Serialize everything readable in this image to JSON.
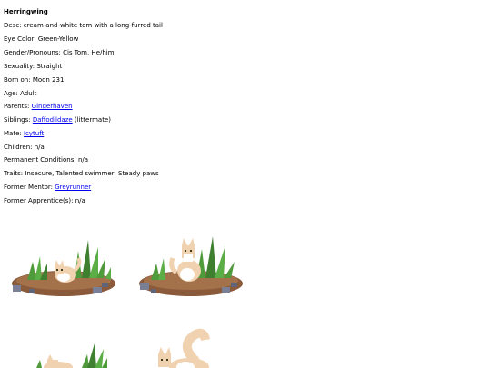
{
  "character": {
    "name": "Herringwing",
    "fields": [
      {
        "label": "Desc: ",
        "value": "cream-and-white tom with a long-furred tail",
        "link": "",
        "suffix": ""
      },
      {
        "label": "Eye Color: ",
        "value": "Green-Yellow",
        "link": "",
        "suffix": ""
      },
      {
        "label": "Gender/Pronouns: ",
        "value": "Cis Tom, He/him",
        "link": "",
        "suffix": ""
      },
      {
        "label": "Sexuality: ",
        "value": "Straight",
        "link": "",
        "suffix": ""
      },
      {
        "label": "Born on: ",
        "value": "Moon 231",
        "link": "",
        "suffix": ""
      },
      {
        "label": "Age: ",
        "value": "Adult",
        "link": "",
        "suffix": ""
      },
      {
        "label": "Parents: ",
        "value": "",
        "link": "Gingerhaven",
        "suffix": ""
      },
      {
        "label": "Siblings: ",
        "value": "",
        "link": "Daffodildaze",
        "suffix": " (littermate)"
      },
      {
        "label": "Mate: ",
        "value": "",
        "link": "Icytuft",
        "suffix": ""
      },
      {
        "label": "Children: ",
        "value": "n/a",
        "link": "",
        "suffix": ""
      },
      {
        "label": "Permanent Conditions: ",
        "value": "n/a",
        "link": "",
        "suffix": ""
      },
      {
        "label": "Traits: ",
        "value": "Insecure, Talented swimmer, Steady paws",
        "link": "",
        "suffix": ""
      },
      {
        "label": "Former Mentor: ",
        "value": "",
        "link": "Greyrunner",
        "suffix": ""
      },
      {
        "label": "Former Apprentice(s): ",
        "value": "n/a",
        "link": "",
        "suffix": ""
      }
    ]
  },
  "sprites": [
    {
      "name": "kit-sprite"
    },
    {
      "name": "adolescent-sprite"
    },
    {
      "name": "young-adult-sprite"
    },
    {
      "name": "adult-sprite"
    }
  ],
  "colors": {
    "link": "#0000ee",
    "cat_cream": "#f1d2b0",
    "cat_white": "#ffffff",
    "dirt": "#8a5a3a",
    "grass": "#4f9a3a",
    "stone": "#7a7f95"
  }
}
